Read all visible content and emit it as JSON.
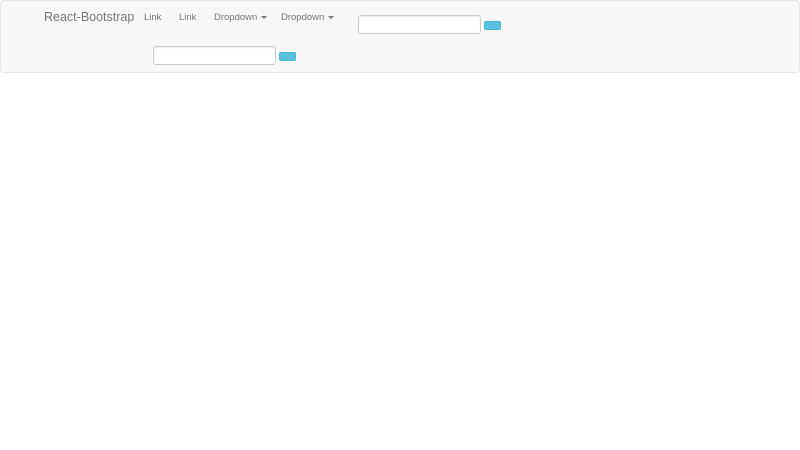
{
  "navbar": {
    "brand": "React-Bootstrap",
    "links": [
      {
        "label": "Link"
      },
      {
        "label": "Link"
      }
    ],
    "dropdowns": [
      {
        "label": "Dropdown"
      },
      {
        "label": "Dropdown"
      }
    ],
    "search_forms": [
      {
        "value": "",
        "placeholder": ""
      },
      {
        "value": "",
        "placeholder": ""
      }
    ],
    "colors": {
      "background": "#f8f8f8",
      "border": "#e7e7e7",
      "text": "#777777",
      "button": "#5bc0de"
    }
  }
}
